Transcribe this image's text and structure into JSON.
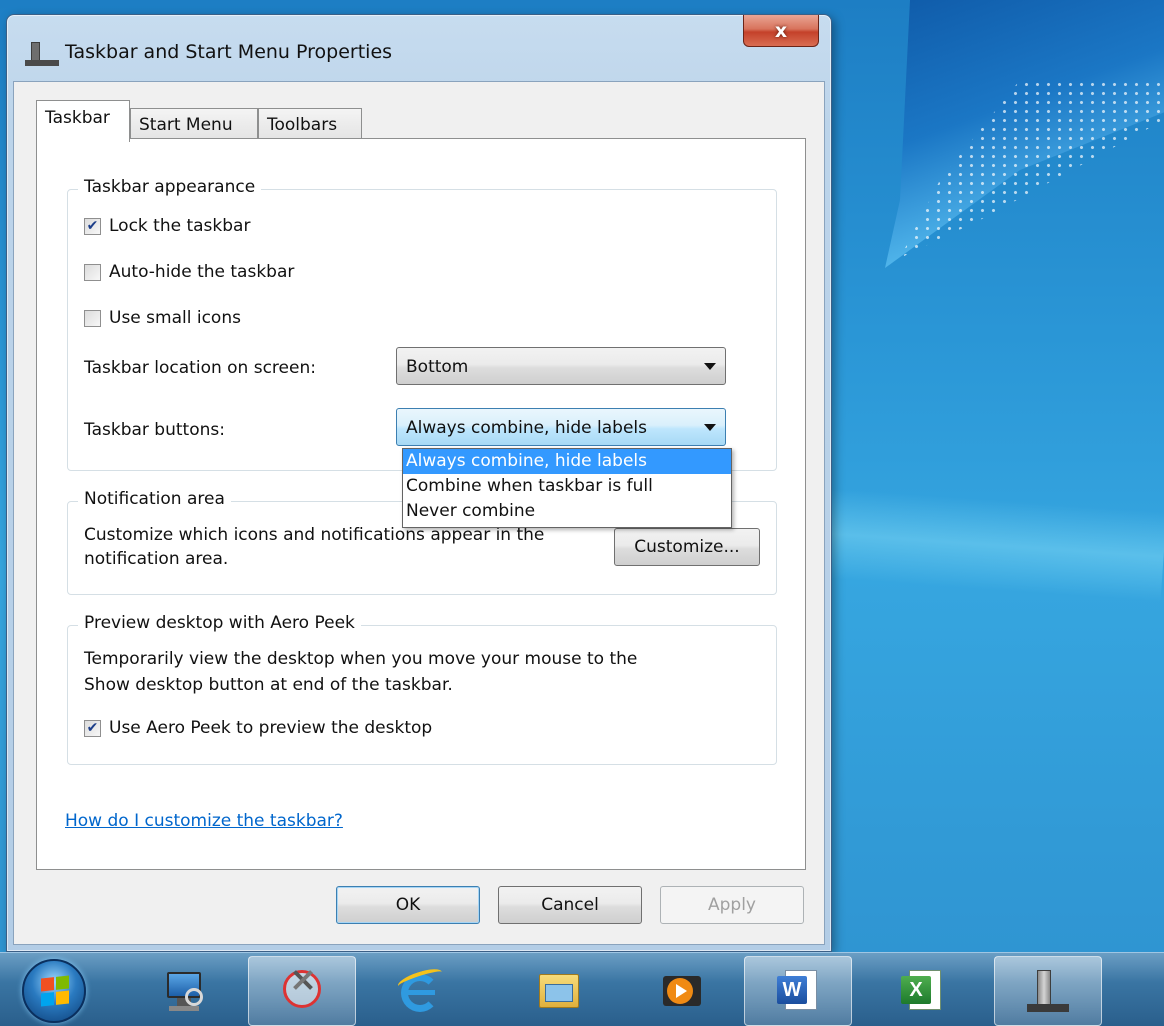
{
  "window": {
    "title": "Taskbar and Start Menu Properties",
    "close_label": "x"
  },
  "tabs": [
    {
      "label": "Taskbar",
      "active": true
    },
    {
      "label": "Start Menu",
      "active": false
    },
    {
      "label": "Toolbars",
      "active": false
    }
  ],
  "appearance": {
    "legend": "Taskbar appearance",
    "lock": {
      "label": "Lock the taskbar",
      "checked": true
    },
    "autohide": {
      "label": "Auto-hide the taskbar",
      "checked": false
    },
    "small_icons": {
      "label": "Use small icons",
      "checked": false
    },
    "location_label": "Taskbar location on screen:",
    "location_value": "Bottom",
    "buttons_label": "Taskbar buttons:",
    "buttons_value": "Always combine, hide labels",
    "buttons_options": [
      "Always combine, hide labels",
      "Combine when taskbar is full",
      "Never combine"
    ]
  },
  "notification": {
    "legend": "Notification area",
    "text_line1": "Customize which icons and notifications appear in the",
    "text_line2": "notification area.",
    "customize_button": "Customize..."
  },
  "peek": {
    "legend": "Preview desktop with Aero Peek",
    "text_line1": "Temporarily view the desktop when you move your mouse to the",
    "text_line2": "Show desktop button at end of the taskbar.",
    "use_peek": {
      "label": "Use Aero Peek to preview the desktop",
      "checked": true
    }
  },
  "help_link": "How do I customize the taskbar?",
  "buttons": {
    "ok": "OK",
    "cancel": "Cancel",
    "apply": "Apply"
  },
  "checkmark_glyph": "✔",
  "taskbar": {
    "items": [
      "start-orb",
      "remote-desktop-icon",
      "snipping-tool-icon",
      "internet-explorer-icon",
      "windows-explorer-icon",
      "media-player-icon",
      "word-icon",
      "excel-icon",
      "taskbar-properties-icon"
    ]
  }
}
